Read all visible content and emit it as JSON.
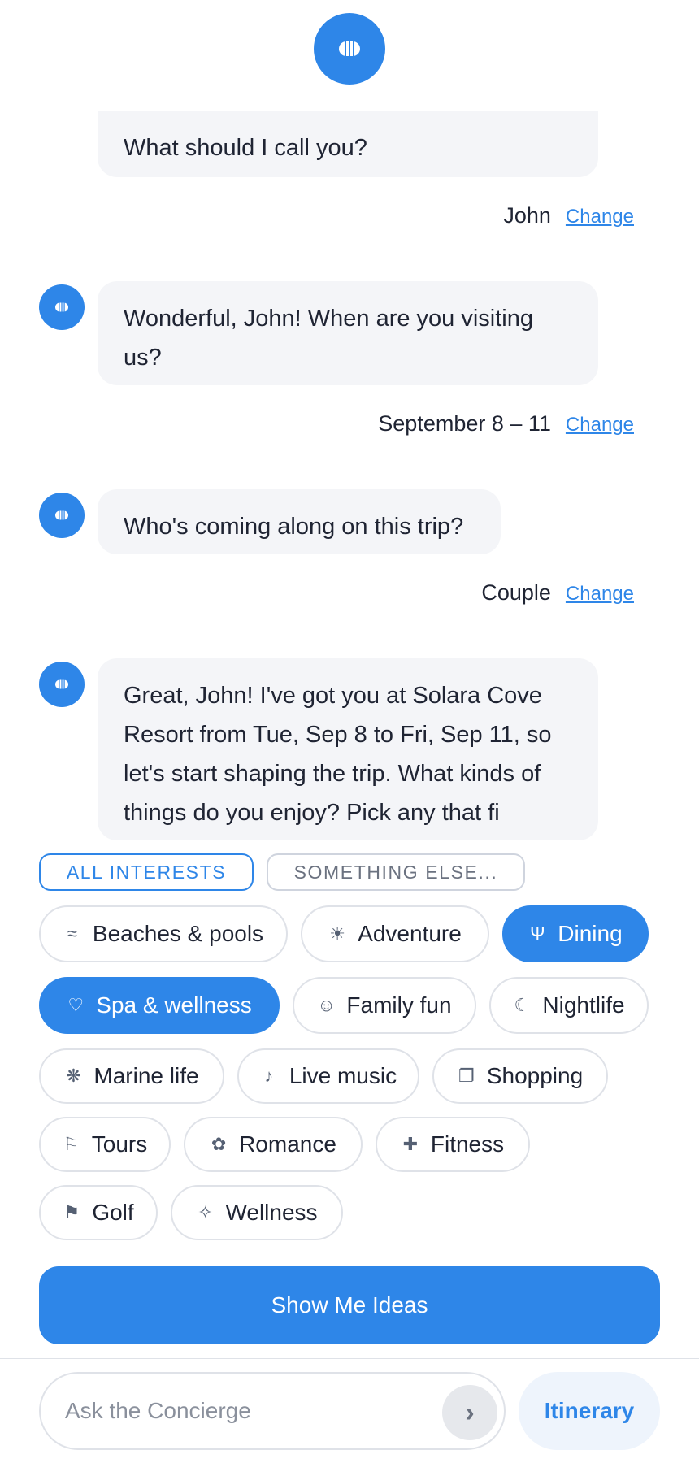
{
  "assistant_icon": "concierge-bell-icon",
  "colors": {
    "accent": "#2e86e8",
    "bubble": "#f4f5f8",
    "chip_border": "#dfe2e8"
  },
  "messages": [
    {
      "text": "What should I call you?",
      "answer": "John"
    },
    {
      "text": "Wonderful, John! When are you visiting us?",
      "answer": "September 8 – 11"
    },
    {
      "text": "Who's coming along on this trip?",
      "answer": "Couple"
    },
    {
      "text": "Great, John! I've got you at Solara Cove Resort from Tue, Sep 8 to Fri, Sep 11, so let's start shaping the trip. What kinds of things do you enjoy? Pick any that fi"
    }
  ],
  "change_label": "Change",
  "filters": {
    "all": "ALL INTERESTS",
    "other": "SOMETHING ELSE..."
  },
  "interests": [
    {
      "label": "Beaches & pools",
      "icon": "≈",
      "icon_name": "waves-icon",
      "selected": false
    },
    {
      "label": "Adventure",
      "icon": "☀",
      "icon_name": "sun-icon",
      "selected": false
    },
    {
      "label": "Dining",
      "icon": "Ψ",
      "icon_name": "fork-icon",
      "selected": true
    },
    {
      "label": "Spa & wellness",
      "icon": "♡",
      "icon_name": "heart-icon",
      "selected": true
    },
    {
      "label": "Family fun",
      "icon": "☺",
      "icon_name": "smiley-icon",
      "selected": false
    },
    {
      "label": "Nightlife",
      "icon": "☾",
      "icon_name": "moon-icon",
      "selected": false
    },
    {
      "label": "Marine life",
      "icon": "❋",
      "icon_name": "coral-icon",
      "selected": false
    },
    {
      "label": "Live music",
      "icon": "♪",
      "icon_name": "music-note-icon",
      "selected": false
    },
    {
      "label": "Shopping",
      "icon": "❐",
      "icon_name": "bag-icon",
      "selected": false
    },
    {
      "label": "Tours",
      "icon": "⚐",
      "icon_name": "flag-outline-icon",
      "selected": false
    },
    {
      "label": "Romance",
      "icon": "✿",
      "icon_name": "flower-icon",
      "selected": false
    },
    {
      "label": "Fitness",
      "icon": "✚",
      "icon_name": "plus-icon",
      "selected": false
    },
    {
      "label": "Golf",
      "icon": "⚑",
      "icon_name": "golf-flag-icon",
      "selected": false
    },
    {
      "label": "Wellness",
      "icon": "✧",
      "icon_name": "sparkle-icon",
      "selected": false
    }
  ],
  "cta": "Show Me Ideas",
  "composer": {
    "placeholder": "Ask the Concierge",
    "send_icon": "›",
    "itinerary": "Itinerary"
  }
}
